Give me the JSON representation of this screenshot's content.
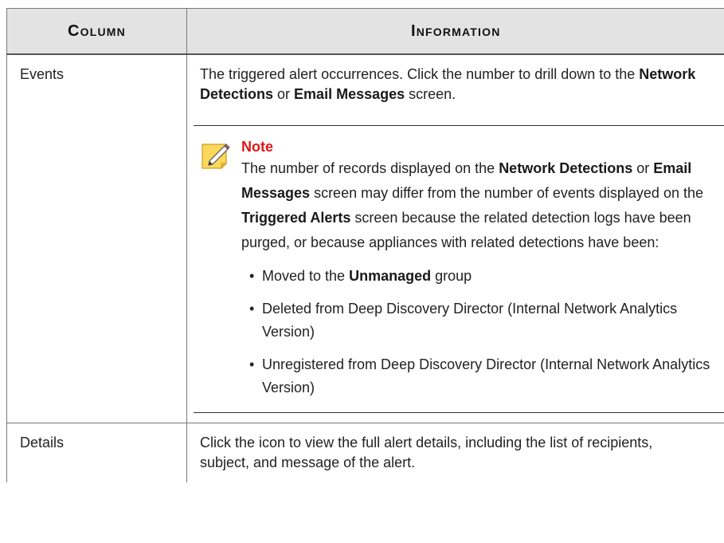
{
  "table": {
    "headers": {
      "column": "Column",
      "information": "Information"
    },
    "events_row": {
      "column": "Events",
      "intro_part1": "The triggered alert occurrences. Click the number to drill down to the ",
      "intro_bold1": "Network Detections",
      "intro_part2": " or ",
      "intro_bold2": "Email Messages",
      "intro_part3": " screen.",
      "note": {
        "icon": "note-pencil-icon",
        "title": "Note",
        "text_part1": "The number of records displayed on the ",
        "text_bold1": "Network Detections",
        "text_part2": " or ",
        "text_bold2": "Email Messages",
        "text_part3": " screen may differ from the number of events displayed on the ",
        "text_bold3": "Triggered Alerts",
        "text_part4": " screen because the related detection logs have been purged, or because appliances with related detections have been:",
        "bullet1_part1": "Moved to the ",
        "bullet1_bold": "Unmanaged",
        "bullet1_part2": " group",
        "bullet2": "Deleted from Deep Discovery Director (Internal Network Analytics Version)",
        "bullet3": "Unregistered from Deep Discovery Director (Internal Network Analytics Version)"
      }
    },
    "details_row": {
      "column": "Details",
      "info": "Click the icon to view the full alert details, including the list of recipients, subject, and message of the alert."
    }
  },
  "colors": {
    "header_bg": "#e3e3e3",
    "note_title": "#e01414",
    "border": "#7a7a7a"
  }
}
